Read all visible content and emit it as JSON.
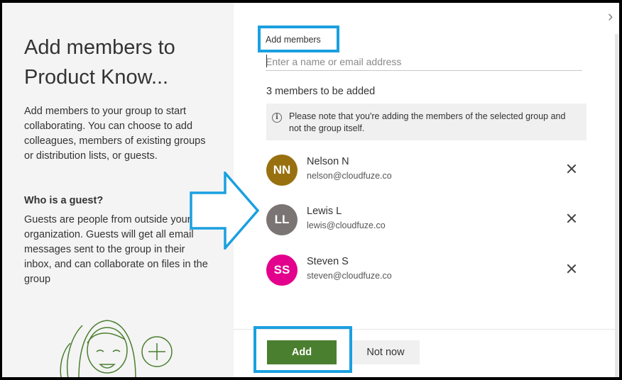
{
  "left_panel": {
    "title": "Add members to Product Know...",
    "description": "Add members to your group to start collaborating. You can choose to add colleagues, members of existing groups or distribution lists, or guests.",
    "guest_heading": "Who is a guest?",
    "guest_text": "Guests are people from outside your organization. Guests will get all email messages sent to the group in their inbox, and can collaborate on files in the group"
  },
  "form": {
    "section_label": "Add members",
    "input_placeholder": "Enter a name or email address",
    "count_text": "3 members to be added",
    "notice": "Please note that you're adding the members of the selected group and not the group itself."
  },
  "members": [
    {
      "initials": "NN",
      "name": "Nelson N",
      "email": "nelson@cloudfuze.co",
      "color": "#98700f"
    },
    {
      "initials": "LL",
      "name": "Lewis L",
      "email": "lewis@cloudfuze.co",
      "color": "#7a7574"
    },
    {
      "initials": "SS",
      "name": "Steven S",
      "email": "steven@cloudfuze.co",
      "color": "#e3008c"
    }
  ],
  "footer": {
    "add_label": "Add",
    "not_now_label": "Not now"
  },
  "colors": {
    "accent_green": "#4a7f2f",
    "highlight_blue": "#1aa0e0"
  },
  "icons": {
    "close": "close-icon",
    "info": "info-icon",
    "remove": "remove-icon",
    "annotation": "arrow-right-icon"
  }
}
